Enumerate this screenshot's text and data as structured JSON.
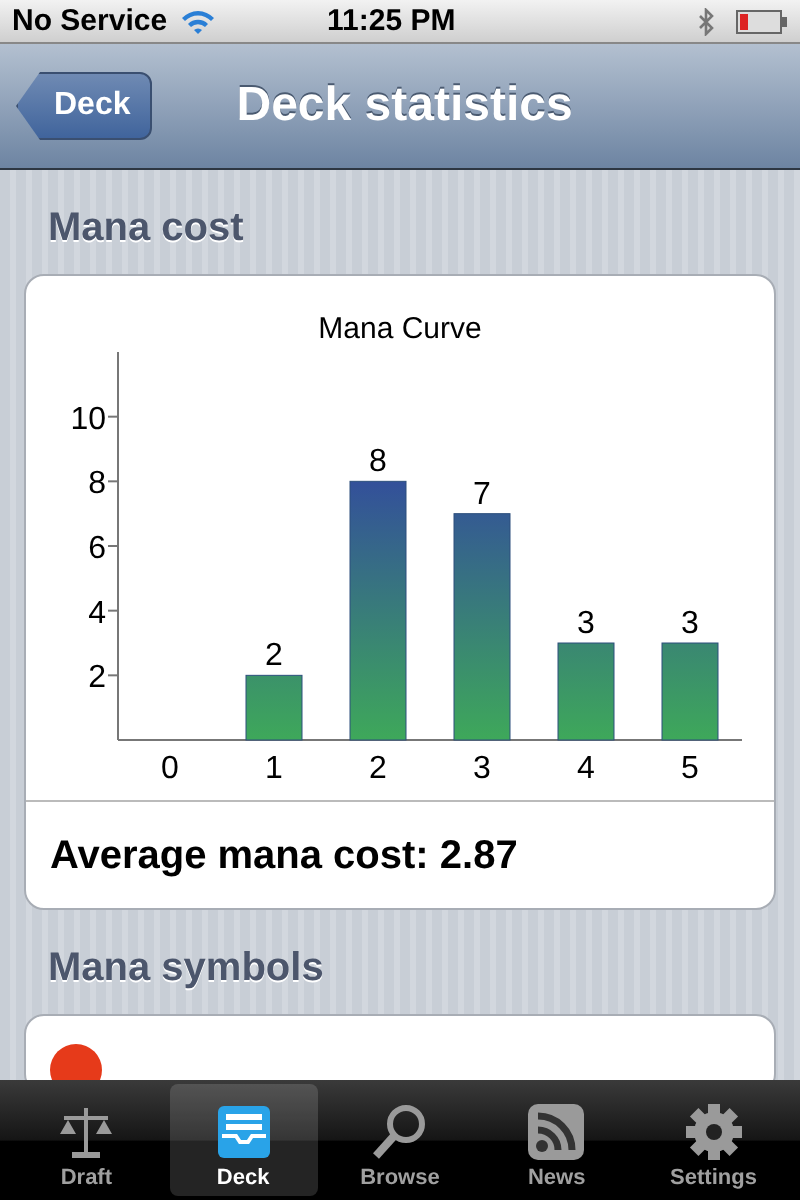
{
  "status_bar": {
    "carrier": "No Service",
    "time": "11:25 PM"
  },
  "nav_bar": {
    "back": "Deck",
    "title": "Deck statistics"
  },
  "sections": [
    {
      "header": "Mana cost",
      "chart_data": {
        "type": "bar",
        "title": "Mana Curve",
        "categories": [
          "0",
          "1",
          "2",
          "3",
          "4",
          "5"
        ],
        "values": [
          0,
          2,
          8,
          7,
          3,
          3
        ],
        "ylim": [
          0,
          12
        ],
        "yticks": [
          2,
          4,
          6,
          8,
          10
        ],
        "value_labels": [
          null,
          "2",
          "8",
          "7",
          "3",
          "3"
        ]
      },
      "footer": "Average mana cost: 2.87"
    },
    {
      "header": "Mana symbols"
    }
  ],
  "tabs": [
    {
      "label": "Draft",
      "kind": "scales",
      "selected": false
    },
    {
      "label": "Deck",
      "kind": "tray",
      "selected": true
    },
    {
      "label": "Browse",
      "kind": "search",
      "selected": false
    },
    {
      "label": "News",
      "kind": "feed",
      "selected": false
    },
    {
      "label": "Settings",
      "kind": "gear",
      "selected": false
    }
  ]
}
